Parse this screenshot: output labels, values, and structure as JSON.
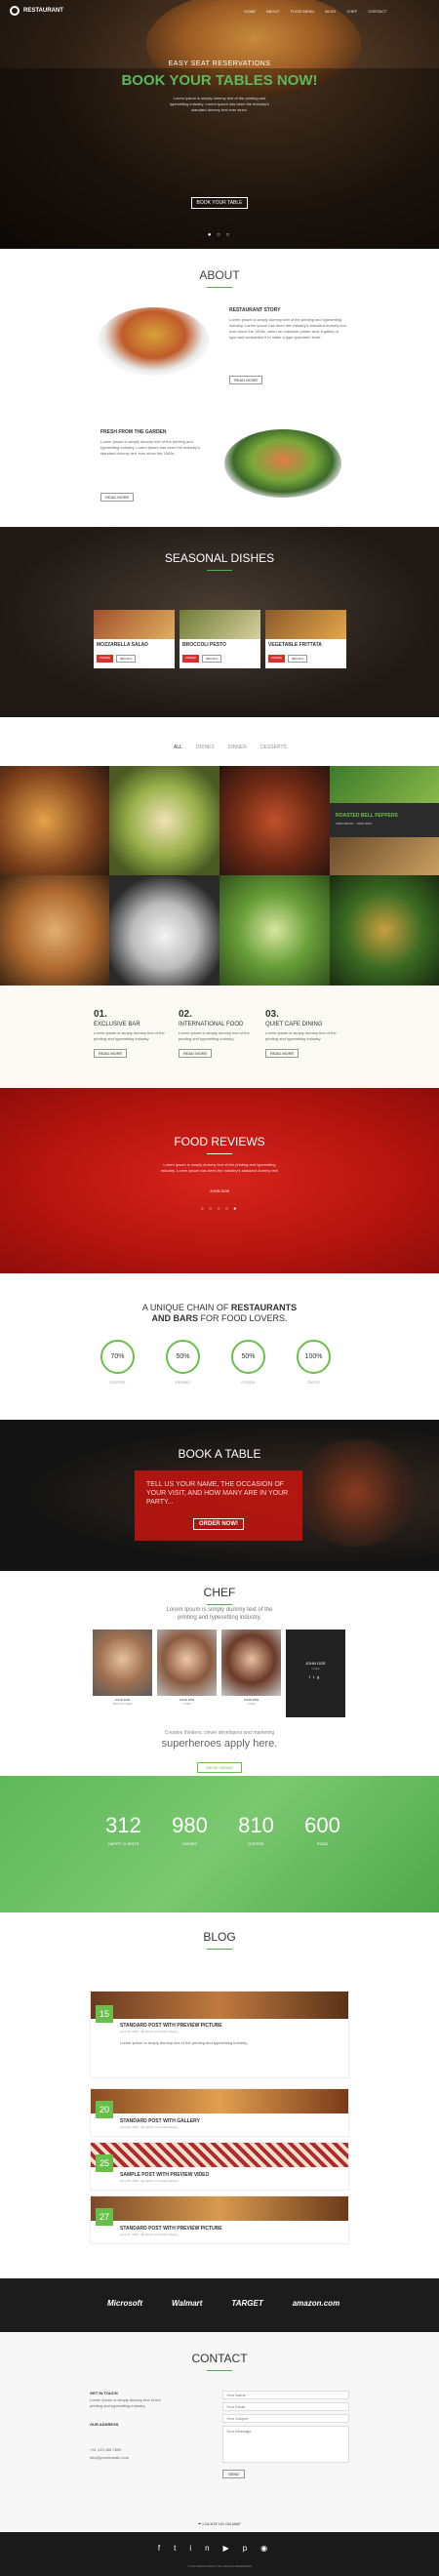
{
  "nav": {
    "brand": "RESTAURANT",
    "items": [
      "HOME",
      "ABOUT",
      "FOOD MENU",
      "BLOG",
      "CHEF",
      "CONTACT"
    ]
  },
  "hero": {
    "kicker": "EASY SEAT RESERVATIONS",
    "title": "BOOK YOUR TABLES NOW!",
    "text": "Lorem Ipsum is simply dummy text of the printing and typesetting industry. Lorem Ipsum has been the industry's standard dummy text ever since.",
    "button": "BOOK YOUR TABLE"
  },
  "about": {
    "title": "ABOUT",
    "story_title": "RESTAURANT STORY",
    "story_text": "Lorem Ipsum is simply dummy text of the printing and typesetting industry. Lorem Ipsum has been the industry's standard dummy text ever since the 1500s, when an unknown printer took a galley of type and scrambled it to make a type specimen book.",
    "story_button": "READ MORE",
    "garden_title": "FRESH FROM THE GARDEN",
    "garden_text": "Lorem Ipsum is simply dummy text of the printing and typesetting industry. Lorem Ipsum has been the industry's standard dummy text ever since the 1500s.",
    "garden_button": "READ MORE"
  },
  "seasonal": {
    "title": "SEASONAL DISHES",
    "dishes": [
      {
        "name": "MOZZARELLA SALAD",
        "color": "#a24e2c"
      },
      {
        "name": "BROCCOLI PESTO",
        "color": "#6d7b34"
      },
      {
        "name": "VEGETABLE FRITTATA",
        "color": "#8a5a2b"
      }
    ],
    "order": "ORDER",
    "more": "DETAILS"
  },
  "filters": [
    "ALL",
    "DRINKS",
    "DINNER",
    "DESSERTS"
  ],
  "gallery": {
    "caption": "ROASTED BELL PEPPERS",
    "sub": "VIEW DETAIL · VIEW DISH"
  },
  "features": [
    {
      "num": "01.",
      "title": "EXCLUSIVE BAR"
    },
    {
      "num": "02.",
      "title": "INTERNATIONAL FOOD"
    },
    {
      "num": "03.",
      "title": "QUIET CAFE DINING"
    }
  ],
  "feature_text": "Lorem Ipsum is simply dummy text of the printing and typesetting industry.",
  "feature_button": "READ MORE",
  "reviews": {
    "title": "FOOD REVIEWS",
    "text": "Lorem Ipsum is simply dummy text of the printing and typesetting industry. Lorem Ipsum has been the industry's standard dummy text",
    "author": "JOHN DOE"
  },
  "chain": {
    "line1": "A UNIQUE CHAIN OF ",
    "bold1": "RESTAURANTS",
    "line2": "AND BARS",
    "line2b": " FOR FOOD LOVERS."
  },
  "stats": [
    {
      "value": "70%",
      "label": "COFFEE",
      "pct": 70
    },
    {
      "value": "50%",
      "label": "DRINKS",
      "pct": 50
    },
    {
      "value": "50%",
      "label": "FOODS",
      "pct": 50
    },
    {
      "value": "100%",
      "label": "TASTE",
      "pct": 100
    }
  ],
  "book": {
    "title": "BOOK A TABLE",
    "text": "TELL US YOUR NAME, THE OCCASION OF YOUR VISIT, AND HOW MANY ARE IN YOUR PARTY...",
    "button": "ORDER NOW!"
  },
  "chef": {
    "title": "CHEF",
    "subtitle": "Lorem Ipsum is simply dummy text of the printing and typesetting industry.",
    "members": [
      {
        "name": "JOHN DOE",
        "role": "SENIOR CHEF"
      },
      {
        "name": "JOHN DOE",
        "role": "CHEF"
      },
      {
        "name": "JOHN DOE",
        "role": "CHEF"
      },
      {
        "name": "JOHN DOE",
        "role": "CHEF"
      }
    ],
    "hire1": "Creative thinkers, clever developers and marketing",
    "hire2": "superheroes apply here.",
    "hire_button": "WE'RE HIRING"
  },
  "counters": [
    {
      "value": "312",
      "label": "HAPPY CLIENTS"
    },
    {
      "value": "980",
      "label": "DISHES"
    },
    {
      "value": "810",
      "label": "COFFEE"
    },
    {
      "value": "600",
      "label": "PIZZA"
    }
  ],
  "blog": {
    "title": "BLOG",
    "posts": [
      {
        "day": "15",
        "title": "STANDARD POST WITH PREVIEW PICTURE",
        "meta": "June 15, 2015 · By admin in Creative Design"
      },
      {
        "day": "20",
        "title": "STANDARD POST WITH GALLERY",
        "meta": "June 20, 2015 · By admin in Creative Design"
      },
      {
        "day": "25",
        "title": "SAMPLE POST WITH PREVIEW VIDEO",
        "meta": "June 25, 2015 · By admin in Creative Design"
      },
      {
        "day": "27",
        "title": "STANDARD POST WITH PREVIEW PICTURE",
        "meta": "June 27, 2015 · By admin in Creative Design"
      }
    ],
    "excerpt": "Lorem Ipsum is simply dummy text of the printing and typesetting industry."
  },
  "logos": [
    "Microsoft",
    "Walmart",
    "TARGET",
    "amazon.com"
  ],
  "contact": {
    "title": "CONTACT",
    "heading": "GET IN TOUCH",
    "about_us": "OUR ADDRESS",
    "phone": "+91 123 456 7890",
    "email": "info@yourdomain.com",
    "fields": [
      "Your Name",
      "Your Email",
      "Your Subject"
    ],
    "message": "Your Message",
    "send": "SEND",
    "map_link": "LOCATE US ON MAP"
  },
  "footer": {
    "copyright": "© 2015 RESTAURANT. ALL RIGHTS RESERVED."
  }
}
